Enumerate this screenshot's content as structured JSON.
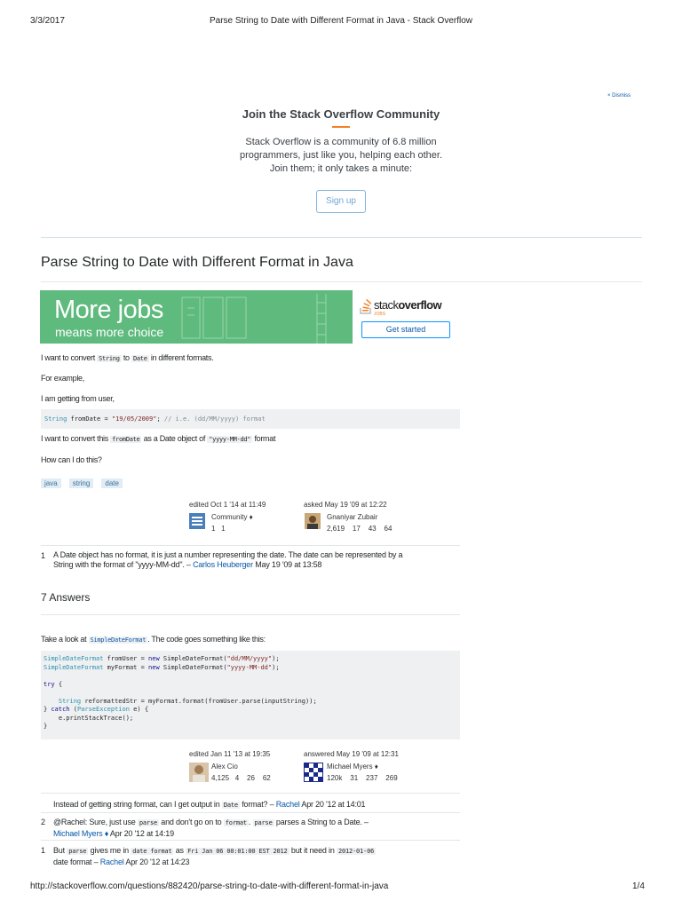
{
  "print_header": {
    "date": "3/3/2017",
    "title": "Parse String to Date with Different Format in Java - Stack Overflow"
  },
  "banner": {
    "dismiss": "× Dismiss",
    "heading": "Join the Stack Overflow Community",
    "body_lines": [
      "Stack Overflow is a community of 6.8 million",
      "programmers, just like you, helping each other.",
      "Join them; it only takes a minute:"
    ],
    "signup_label": "Sign up"
  },
  "question": {
    "title": "Parse String to Date with Different Format in Java",
    "ad": {
      "headline": "More jobs",
      "subline": "means more choice",
      "brand": "stackoverflow",
      "brand_prefix": "stack",
      "brand_suffix": "overflow",
      "brand_sub": "JOBS",
      "cta": "Get started"
    },
    "p1_pre": "I want to convert",
    "p1_code1": "String",
    "p1_mid": "to",
    "p1_code2": "Date",
    "p1_post": "in different formats.",
    "p2": "For example,",
    "p3": "I am getting from user,",
    "code_line": {
      "type": "String",
      "var": " fromDate = ",
      "str": "\"19/05/2009\"",
      "semi": "; ",
      "comment": "// i.e. (dd/MM/yyyy) format"
    },
    "p4_pre": "I want to convert this",
    "p4_code": "fromDate",
    "p4_mid": "as a Date object of",
    "p4_code2": "\"yyyy-MM-dd\"",
    "p4_post": "format",
    "p5": "How can I do this?",
    "tags": [
      "java",
      "string",
      "date"
    ],
    "edited": {
      "label": "edited Oct 1 '14 at 11:49",
      "user": "Community ♦",
      "rep": "1",
      "badge": "1"
    },
    "asked": {
      "label": "asked May 19 '09 at 12:22",
      "user": "Gnaniyar Zubair",
      "rep": "2,619",
      "gold": "17",
      "silver": "43",
      "bronze": "64"
    },
    "comment": {
      "score": "1",
      "text_line1": "A Date object has no format, it is just a number representing the date. The date can be represented by a",
      "text_line2_pre": "String with the format of \"yyyy-MM-dd\". –",
      "author": "Carlos Heuberger",
      "time": "May 19 '09 at 13:58"
    }
  },
  "answers": {
    "count_label": "7 Answers",
    "first": {
      "p1_pre": "Take a look at",
      "p1_code": "SimpleDateFormat",
      "p1_post": ". The code goes something like this:",
      "code": [
        [
          {
            "t": "SimpleDateFormat",
            "c": "typ"
          },
          {
            "t": " fromUser = ",
            "c": ""
          },
          {
            "t": "new",
            "c": "kw"
          },
          {
            "t": " SimpleDateFormat(",
            "c": ""
          },
          {
            "t": "\"dd/MM/yyyy\"",
            "c": "str"
          },
          {
            "t": ");",
            "c": ""
          }
        ],
        [
          {
            "t": "SimpleDateFormat",
            "c": "typ"
          },
          {
            "t": " myFormat = ",
            "c": ""
          },
          {
            "t": "new",
            "c": "kw"
          },
          {
            "t": " SimpleDateFormat(",
            "c": ""
          },
          {
            "t": "\"yyyy-MM-dd\"",
            "c": "str"
          },
          {
            "t": ");",
            "c": ""
          }
        ],
        [],
        [
          {
            "t": "try",
            "c": "kw"
          },
          {
            "t": " {",
            "c": ""
          }
        ],
        [],
        [
          {
            "t": "    ",
            "c": ""
          },
          {
            "t": "String",
            "c": "typ"
          },
          {
            "t": " reformattedStr = myFormat.format(fromUser.parse(inputString));",
            "c": ""
          }
        ],
        [
          {
            "t": "} ",
            "c": ""
          },
          {
            "t": "catch",
            "c": "kw"
          },
          {
            "t": " (",
            "c": ""
          },
          {
            "t": "ParseException",
            "c": "typ"
          },
          {
            "t": " e) {",
            "c": ""
          }
        ],
        [
          {
            "t": "    e.printStackTrace();",
            "c": ""
          }
        ],
        [
          {
            "t": "}",
            "c": ""
          }
        ]
      ],
      "edited": {
        "label": "edited Jan 11 '13 at 19:35",
        "user": "Alex Cio",
        "rep": "4,125",
        "gold": "4",
        "silver": "26",
        "bronze": "62"
      },
      "answered": {
        "label": "answered May 19 '09 at 12:31",
        "user": "Michael Myers ♦",
        "rep": "120k",
        "gold": "31",
        "silver": "237",
        "bronze": "269"
      },
      "comments": [
        {
          "score": "",
          "pre": "Instead of getting string format, can I get output in",
          "code": "Date",
          "post": "format? –",
          "author": "Rachel",
          "time": "Apr 20 '12 at 14:01"
        },
        {
          "score": "2",
          "pre": "@Rachel: Sure, just use",
          "code": "parse",
          "mid": "and don't go on to",
          "code2": "format",
          "mid2": ".",
          "code3": "parse",
          "post": "parses a String to a Date. –",
          "author": "Michael Myers ♦",
          "time": "Apr 20 '12 at 14:19"
        },
        {
          "score": "1",
          "pre": "But",
          "code": "parse",
          "mid": "gives me in",
          "code2": "date format",
          "mid2": "as",
          "code3": "Fri Jan 06 00:01:00 EST 2012",
          "mid3": "but it need in",
          "code4": "2012-01-06",
          "post": "date format –",
          "author": "Rachel",
          "time": "Apr 20 '12 at 14:23"
        }
      ]
    }
  },
  "print_footer": {
    "url": "http://stackoverflow.com/questions/882420/parse-string-to-date-with-different-format-in-java",
    "page": "1/4"
  },
  "colors": {
    "accent_orange": "#f48024",
    "ad_green": "#5fba7d",
    "link_blue": "#0a5aa8"
  }
}
